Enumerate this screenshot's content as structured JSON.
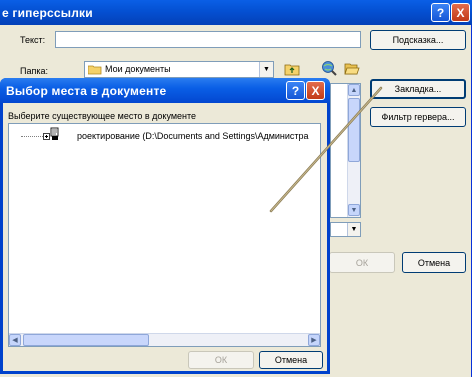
{
  "back_window": {
    "title": "е гиперссылки",
    "help_button": "?",
    "close_button": "X",
    "text_label": "Текст:",
    "text_value": "",
    "tooltip_button": "Подсказка...",
    "folder_label": "Папка:",
    "folder_value": "Мои документы",
    "bookmark_button": "Закладка...",
    "target_frame_button": "Фильтр гервера...",
    "ok_button": "ОК",
    "cancel_button": "Отмена"
  },
  "front_dialog": {
    "title": "Выбор места в документе",
    "help_button": "?",
    "close_button": "X",
    "prompt": "Выберите существующее место в документе",
    "tree_item": "роектирование (D:\\Documents and Settings\\Администра",
    "ok_button": "ОК",
    "cancel_button": "Отмена"
  },
  "icons": {
    "folder": "folder-icon",
    "up_folder": "up-folder-icon",
    "web_search": "web-search-icon",
    "open_folder": "open-folder-icon",
    "tree_document": "document-node-icon"
  }
}
